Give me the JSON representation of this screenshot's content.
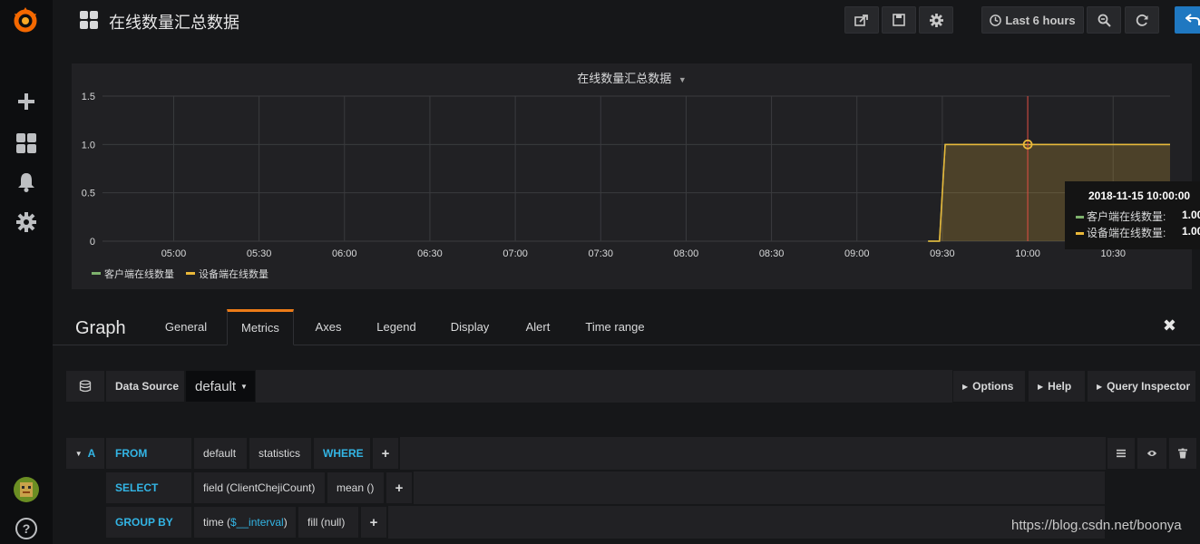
{
  "colors": {
    "accent_orange": "#eb7b18",
    "series_green": "#7eb26d",
    "series_yellow": "#eab839",
    "keyword_blue": "#33b5e5",
    "marker_red": "#e24d42"
  },
  "sidemenu": {
    "icons": [
      "grafana-logo-icon",
      "plus-icon",
      "dashboards-icon",
      "bell-icon",
      "gear-icon",
      "user-avatar",
      "help-icon"
    ],
    "help_label": "?"
  },
  "navbar": {
    "title": "在线数量汇总数据",
    "time_range": "Last 6 hours",
    "icons": [
      "share-icon",
      "save-icon",
      "gear-icon",
      "clock-icon",
      "zoom-out-icon",
      "refresh-icon",
      "back-icon"
    ]
  },
  "panel": {
    "title": "在线数量汇总数据"
  },
  "chart_data": {
    "type": "area",
    "title": "在线数量汇总数据",
    "x": [
      "05:00",
      "05:30",
      "06:00",
      "06:30",
      "07:00",
      "07:30",
      "08:00",
      "08:30",
      "09:00",
      "09:30",
      "10:00",
      "10:30"
    ],
    "x_range": [
      "04:35",
      "10:50"
    ],
    "yticks": [
      "0",
      "0.5",
      "1.0",
      "1.5"
    ],
    "ylim": [
      0,
      1.5
    ],
    "grid": true,
    "legend_position": "bottom-left",
    "series": [
      {
        "name": "客户端在线数量",
        "color": "#7eb26d",
        "points": [
          [
            "09:25",
            0
          ],
          [
            "09:29",
            0
          ],
          [
            "09:31",
            1
          ],
          [
            "10:50",
            1
          ]
        ]
      },
      {
        "name": "设备端在线数量",
        "color": "#eab839",
        "points": [
          [
            "09:25",
            0
          ],
          [
            "09:29",
            0
          ],
          [
            "09:31",
            1
          ],
          [
            "10:50",
            1
          ]
        ]
      }
    ],
    "hover_marker": "10:00",
    "tooltip": {
      "time": "2018-11-15 10:00:00",
      "rows": [
        {
          "name": "客户端在线数量:",
          "value": "1.00",
          "color": "#7eb26d"
        },
        {
          "name": "设备端在线数量:",
          "value": "1.00",
          "color": "#eab839"
        }
      ]
    }
  },
  "editor": {
    "title": "Graph",
    "tabs": [
      "General",
      "Metrics",
      "Axes",
      "Legend",
      "Display",
      "Alert",
      "Time range"
    ],
    "active_tab": "Metrics",
    "close_label": "✖"
  },
  "datasource": {
    "label": "Data Source",
    "value": "default",
    "options_label": "Options",
    "help_label": "Help",
    "inspector_label": "Query Inspector"
  },
  "query": {
    "ref": "A",
    "from_kw": "FROM",
    "from_policy": "default",
    "from_measurement": "statistics",
    "where_kw": "WHERE",
    "select_kw": "SELECT",
    "select_field": "field (ClientChejiCount)",
    "select_fn": "mean ()",
    "group_kw": "GROUP BY",
    "group_time_prefix": "time (",
    "group_time_var": "$__interval",
    "group_time_suffix": ")",
    "group_fill": "fill (null)",
    "plus": "+"
  },
  "watermark": "https://blog.csdn.net/boonya"
}
